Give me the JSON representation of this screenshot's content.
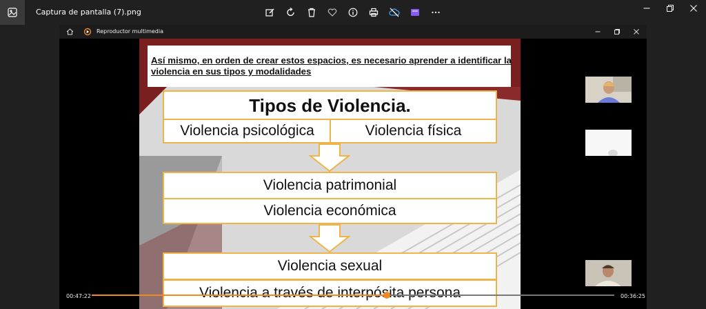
{
  "window": {
    "title": "Captura de pantalla (7).png",
    "toolbar_icons": [
      "edit-image-icon",
      "rotate-icon",
      "delete-icon",
      "favorite-heart-icon",
      "info-icon",
      "print-icon",
      "cloud-off-icon",
      "video-editor-icon",
      "more-options-icon"
    ],
    "controls": [
      "minimize-icon",
      "restore-icon",
      "close-icon"
    ]
  },
  "player": {
    "title": "Reproductor multimedia",
    "current_time": "00:47:22",
    "remaining_time": "00:36:25",
    "progress": 0.565,
    "accent_color": "#f08a24"
  },
  "slide": {
    "intro": "Así mismo, en orden de crear estos espacios, es necesario aprender a identificar la violencia en sus tipos y modalidades",
    "heading": "Tipos de Violencia.",
    "types": {
      "psicologica": "Violencia psicológica",
      "fisica": "Violencia física",
      "patrimonial": "Violencia patrimonial",
      "economica": "Violencia económica",
      "sexual": "Violencia sexual",
      "interposita": "Violencia a través de interpósita persona"
    },
    "border_color": "#f0b34a",
    "header_color": "#7a1f1f"
  },
  "participants": [
    "participant-video-1",
    "participant-video-2",
    "participant-video-3"
  ]
}
